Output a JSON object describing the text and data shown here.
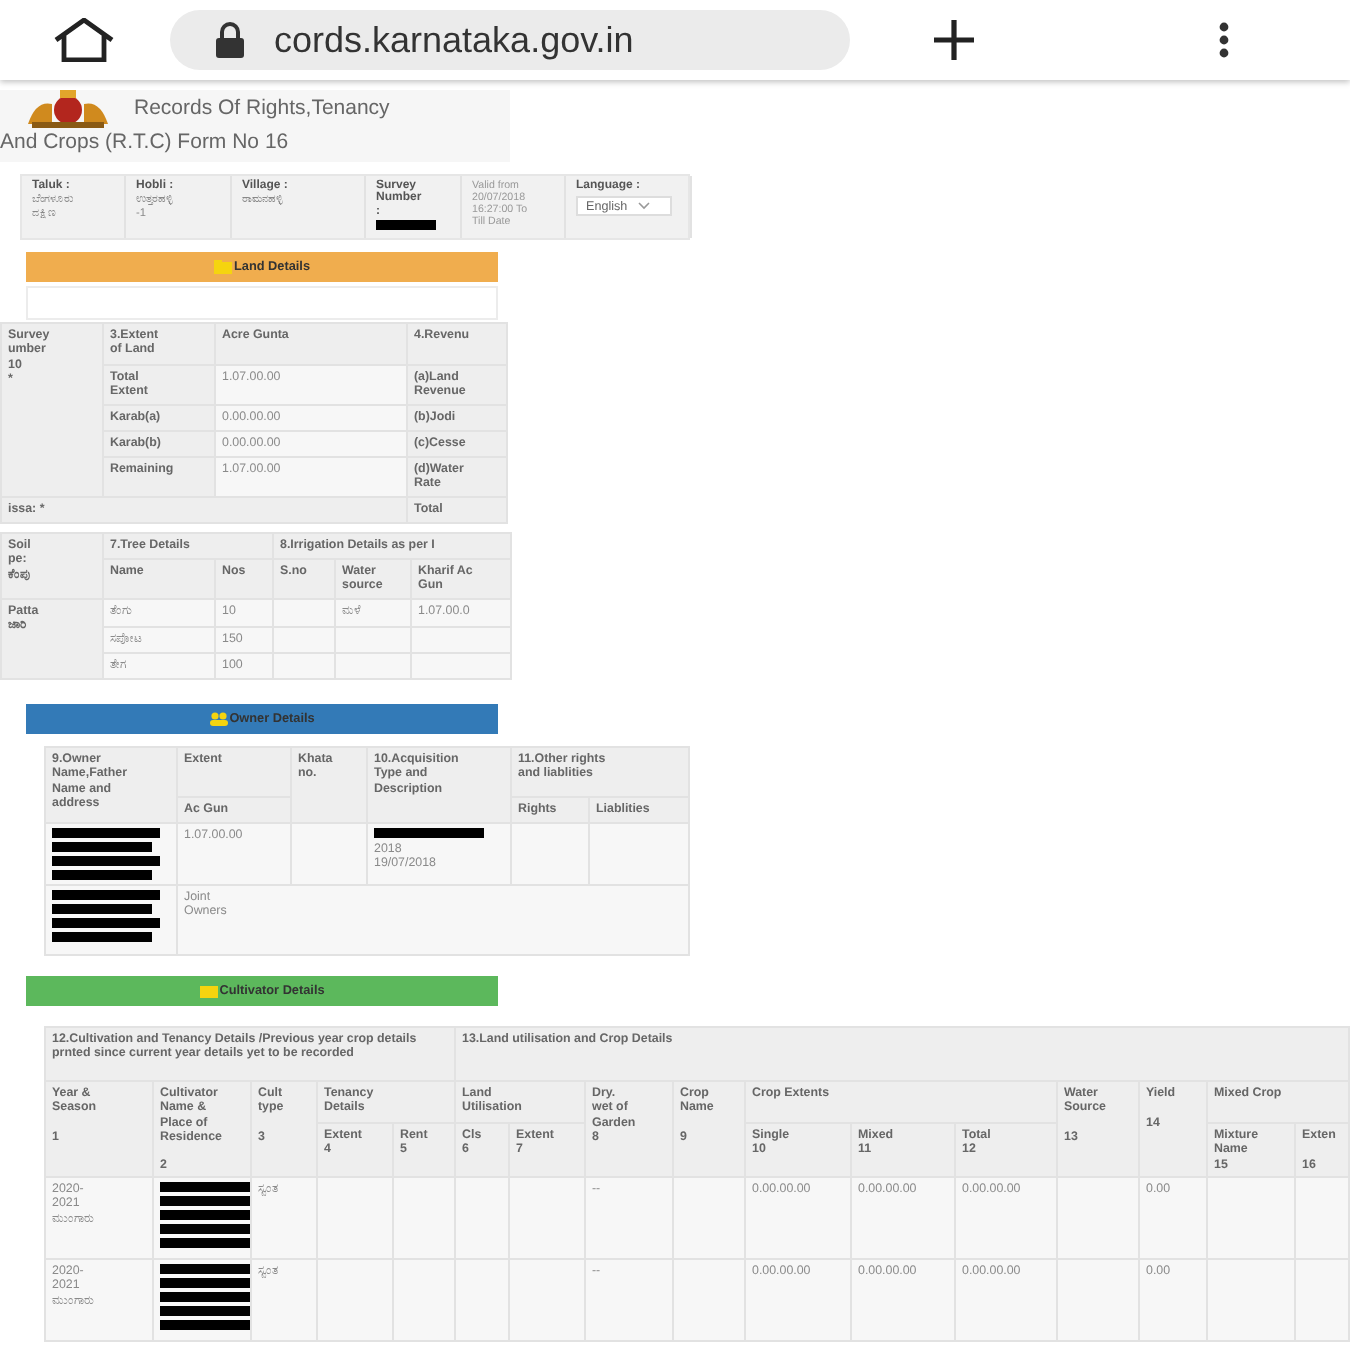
{
  "browser": {
    "url": "cords.karnataka.gov.in"
  },
  "header": {
    "title_lines": [
      "Records Of Rights,Tenancy",
      "And Crops (R.T.C) Form No 16"
    ]
  },
  "info": {
    "fields": [
      {
        "kind": "text",
        "label": "Taluk :",
        "value": "ಬೆಂಗಳೂರು\nದಕ್ಷಿಣ"
      },
      {
        "kind": "text",
        "label": "Hobli :",
        "value": "ಉತ್ತರಹಳ್ಳಿ\n-1"
      },
      {
        "kind": "text",
        "label": "Village :",
        "value": "ರಾಮನಹಳ್ಳಿ"
      },
      {
        "kind": "redacted",
        "label": "Survey\nNumber\n:"
      },
      {
        "kind": "note",
        "value": "Valid from\n20/07/2018\n16:27:00 To\nTill Date"
      },
      {
        "kind": "select",
        "label": "Language :",
        "value": "English"
      }
    ]
  },
  "sections": [
    {
      "title": "Land Details",
      "color": "#f0ad4e",
      "tables": [
        {
          "kind": "land_extent",
          "cells": [
            {
              "text": "Survey\number\n10\n*"
            },
            {
              "text": "3.Extent\nof Land"
            },
            {
              "text": "Acre Gunta"
            },
            {
              "text": "4.Revenu"
            },
            {
              "text": "Total\nExtent"
            },
            {
              "text": "1.07.00.00"
            },
            {
              "text": "(a)Land\nRevenue"
            },
            {
              "text": "Karab(a)"
            },
            {
              "text": "0.00.00.00"
            },
            {
              "text": "(b)Jodi"
            },
            {
              "text": "Karab(b)"
            },
            {
              "text": "0.00.00.00"
            },
            {
              "text": "(c)Cesse"
            },
            {
              "text": "Remaining"
            },
            {
              "text": "1.07.00.00"
            },
            {
              "text": "(d)Water\nRate"
            },
            {
              "text": "issa: *"
            },
            {
              "text": "Total"
            }
          ]
        },
        {
          "kind": "trees",
          "cells": [
            {
              "text": "Soil\npe:\nಕೆಂಪು"
            },
            {
              "text": "7.Tree Details"
            },
            {
              "text": "8.Irrigation Details as per I"
            },
            {
              "text": "Name"
            },
            {
              "text": "Nos"
            },
            {
              "text": "S.no"
            },
            {
              "text": "Water\nsource"
            },
            {
              "text": "Kharif Ac\nGun"
            },
            {
              "text": "Patta\nಜಾರಿ"
            },
            {
              "text": "ತೆಂಗು"
            },
            {
              "text": "10"
            },
            {
              "kind": "blank"
            },
            {
              "text": "ಮಳೆ"
            },
            {
              "text": "1.07.00.0"
            },
            {
              "text": "ಸಪೋಟ"
            },
            {
              "text": "150"
            },
            {
              "kind": "blank"
            },
            {
              "kind": "blank"
            },
            {
              "kind": "blank"
            },
            {
              "text": "ತೇಗ"
            },
            {
              "text": "100"
            },
            {
              "kind": "blank"
            },
            {
              "kind": "blank"
            },
            {
              "kind": "blank"
            }
          ]
        }
      ]
    },
    {
      "title": "Owner Details",
      "color": "#337ab7",
      "tables": [
        {
          "kind": "owners",
          "cells": [
            {
              "text": "9.Owner\nName,Father\nName and\naddress"
            },
            {
              "text": "Extent"
            },
            {
              "text": "Khata\nno."
            },
            {
              "text": "10.Acquisition\nType and\nDescription"
            },
            {
              "text": "11.Other rights\nand liablities"
            },
            {
              "text": "Ac  Gun"
            },
            {
              "text": "Rights"
            },
            {
              "text": "Liablities"
            },
            {
              "kind": "redacted"
            },
            {
              "text": "1.07.00.00"
            },
            {
              "kind": "blank"
            },
            {
              "kind": "redacted_text",
              "text": "2018\n19/07/2018"
            },
            {
              "kind": "blank"
            },
            {
              "kind": "blank"
            },
            {
              "kind": "redacted"
            },
            {
              "text": "Joint\nOwners"
            }
          ]
        }
      ]
    },
    {
      "title": "Cultivator Details",
      "color": "#5cb85c",
      "tables": [
        {
          "kind": "cultivation",
          "cells": [
            {
              "text": "12.Cultivation and Tenancy Details /Previous year crop details prnted since current year details yet to be recorded"
            },
            {
              "text": "13.Land utilisation and Crop Details"
            },
            {
              "text": "Year &\nSeason\n\n1"
            },
            {
              "text": "Cultivator\nName &\nPlace of\nResidence\n\n2"
            },
            {
              "text": "Cult\ntype\n\n3"
            },
            {
              "text": "Tenancy\nDetails"
            },
            {
              "text": "Land\nUtilisation"
            },
            {
              "text": "Dry.\nwet of\nGarden\n8"
            },
            {
              "text": "Crop\nName\n\n9"
            },
            {
              "text": "Crop Extents"
            },
            {
              "text": "Water\nSource\n\n13"
            },
            {
              "text": "Yield\n\n14"
            },
            {
              "text": "Mixed Crop"
            },
            {
              "text": "Extent\n4"
            },
            {
              "text": "Rent\n5"
            },
            {
              "text": "Cls\n6"
            },
            {
              "text": "Extent\n7"
            },
            {
              "text": "Single\n10"
            },
            {
              "text": "Mixed\n11"
            },
            {
              "text": "Total\n12"
            },
            {
              "text": "Mixture\nName\n15"
            },
            {
              "text": "Exten\n\n16"
            },
            {
              "text": "2020-\n2021\nಮುಂಗಾರು"
            },
            {
              "kind": "redacted"
            },
            {
              "text": "ಸ್ವಂತ"
            },
            {
              "kind": "blank"
            },
            {
              "kind": "blank"
            },
            {
              "kind": "blank"
            },
            {
              "kind": "blank"
            },
            {
              "text": "--"
            },
            {
              "kind": "blank"
            },
            {
              "text": "0.00.00.00"
            },
            {
              "text": "0.00.00.00"
            },
            {
              "text": "0.00.00.00"
            },
            {
              "kind": "blank"
            },
            {
              "text": "0.00"
            },
            {
              "kind": "blank"
            },
            {
              "kind": "blank"
            },
            {
              "text": "2020-\n2021\nಮುಂಗಾರು"
            },
            {
              "kind": "redacted"
            },
            {
              "text": "ಸ್ವಂತ"
            },
            {
              "kind": "blank"
            },
            {
              "kind": "blank"
            },
            {
              "kind": "blank"
            },
            {
              "kind": "blank"
            },
            {
              "text": "--"
            },
            {
              "kind": "blank"
            },
            {
              "text": "0.00.00.00"
            },
            {
              "text": "0.00.00.00"
            },
            {
              "text": "0.00.00.00"
            },
            {
              "kind": "blank"
            },
            {
              "text": "0.00"
            },
            {
              "kind": "blank"
            },
            {
              "kind": "blank"
            }
          ]
        }
      ]
    }
  ]
}
